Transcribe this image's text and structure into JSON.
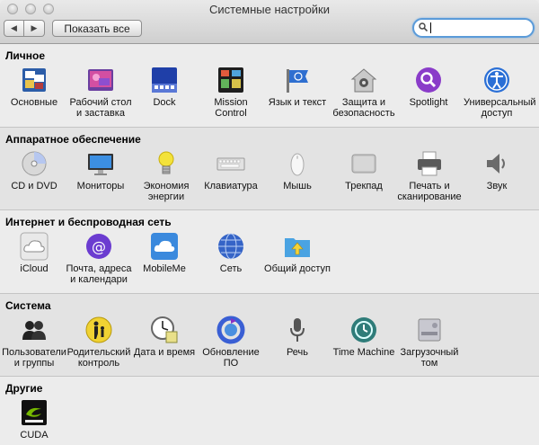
{
  "window": {
    "title": "Системные настройки"
  },
  "toolbar": {
    "show_all_label": "Показать все",
    "search_value": ""
  },
  "sections": [
    {
      "title": "Личное",
      "items": [
        {
          "label": "Основные",
          "icon": "general-icon"
        },
        {
          "label": "Рабочий стол и заставка",
          "icon": "desktop-icon"
        },
        {
          "label": "Dock",
          "icon": "dock-icon"
        },
        {
          "label": "Mission Control",
          "icon": "mission-control-icon"
        },
        {
          "label": "Язык и текст",
          "icon": "language-icon"
        },
        {
          "label": "Защита и безопасность",
          "icon": "security-icon"
        },
        {
          "label": "Spotlight",
          "icon": "spotlight-icon"
        },
        {
          "label": "Универсальный доступ",
          "icon": "accessibility-icon"
        }
      ]
    },
    {
      "title": "Аппаратное обеспечение",
      "items": [
        {
          "label": "CD и DVD",
          "icon": "cd-dvd-icon"
        },
        {
          "label": "Мониторы",
          "icon": "displays-icon"
        },
        {
          "label": "Экономия энергии",
          "icon": "energy-icon"
        },
        {
          "label": "Клавиатура",
          "icon": "keyboard-icon"
        },
        {
          "label": "Мышь",
          "icon": "mouse-icon"
        },
        {
          "label": "Трекпад",
          "icon": "trackpad-icon"
        },
        {
          "label": "Печать и сканирование",
          "icon": "printer-icon"
        },
        {
          "label": "Звук",
          "icon": "sound-icon"
        }
      ]
    },
    {
      "title": "Интернет и беспроводная сеть",
      "items": [
        {
          "label": "iCloud",
          "icon": "icloud-icon"
        },
        {
          "label": "Почта, адреса и календари",
          "icon": "mail-icon"
        },
        {
          "label": "MobileMe",
          "icon": "mobileme-icon"
        },
        {
          "label": "Сеть",
          "icon": "network-icon"
        },
        {
          "label": "Общий доступ",
          "icon": "sharing-icon"
        }
      ]
    },
    {
      "title": "Система",
      "items": [
        {
          "label": "Пользователи и группы",
          "icon": "users-icon"
        },
        {
          "label": "Родительский контроль",
          "icon": "parental-icon"
        },
        {
          "label": "Дата и время",
          "icon": "date-time-icon"
        },
        {
          "label": "Обновление ПО",
          "icon": "software-update-icon"
        },
        {
          "label": "Речь",
          "icon": "speech-icon"
        },
        {
          "label": "Time Machine",
          "icon": "time-machine-icon"
        },
        {
          "label": "Загрузочный том",
          "icon": "startup-disk-icon"
        }
      ]
    },
    {
      "title": "Другие",
      "items": [
        {
          "label": "CUDA",
          "icon": "cuda-icon"
        }
      ]
    }
  ]
}
